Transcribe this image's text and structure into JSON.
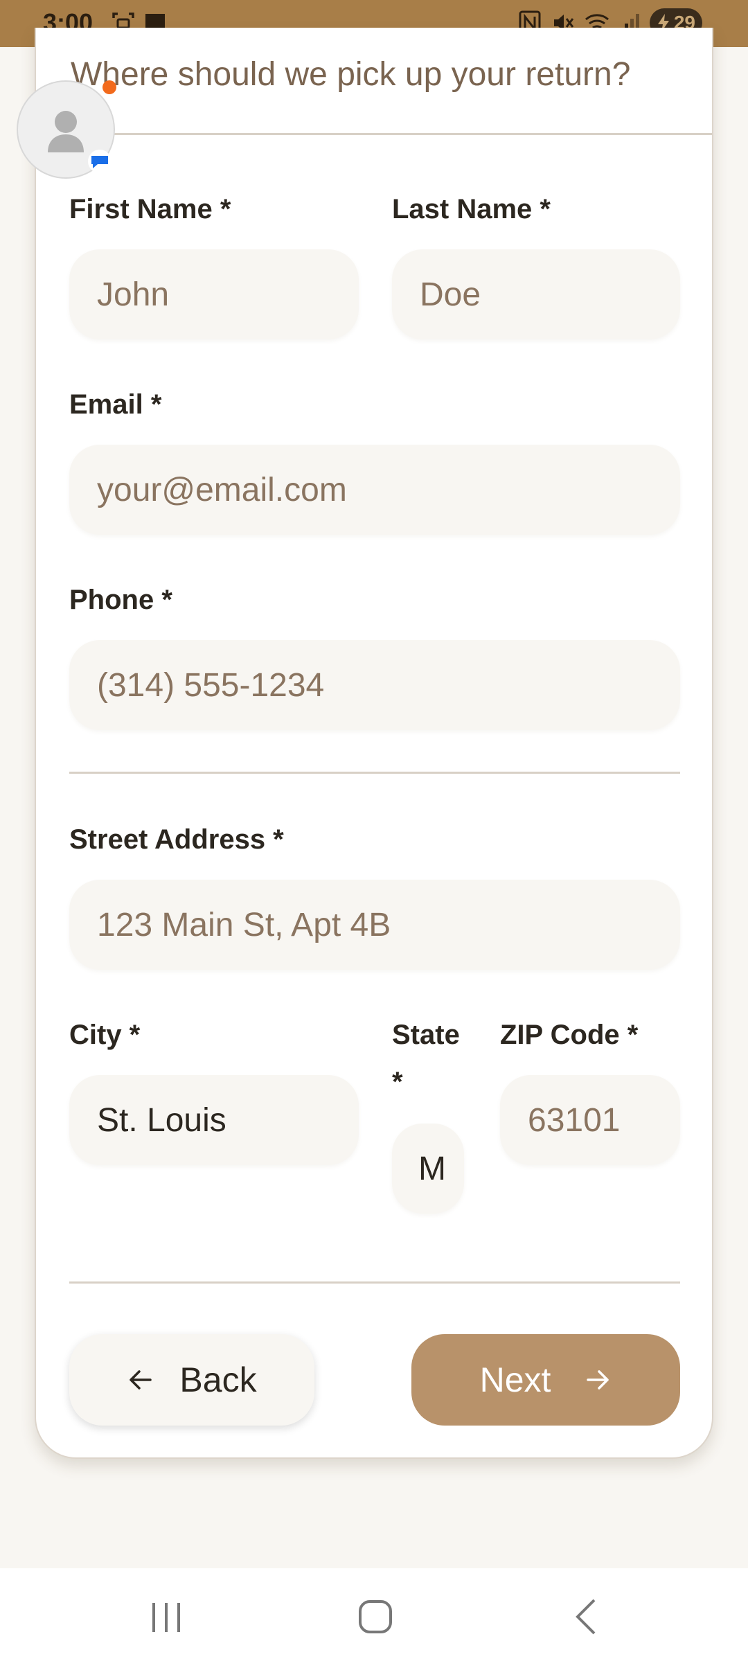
{
  "status_bar": {
    "time": "3:00",
    "battery": "29",
    "icons": [
      "screenshot-icon",
      "chat-icon",
      "nfc-icon",
      "mute-icon",
      "wifi-icon",
      "signal-icon",
      "battery-icon"
    ]
  },
  "form": {
    "subheading": "Where should we pick up your return?",
    "first_name": {
      "label": "First Name *",
      "placeholder": "John"
    },
    "last_name": {
      "label": "Last Name *",
      "placeholder": "Doe"
    },
    "email": {
      "label": "Email *",
      "placeholder": "your@email.com"
    },
    "phone": {
      "label": "Phone *",
      "placeholder": "(314) 555-1234"
    },
    "street": {
      "label": "Street Address *",
      "placeholder": "123 Main St, Apt 4B"
    },
    "city": {
      "label": "City *",
      "value": "St. Louis"
    },
    "state": {
      "label_line1": "State",
      "label_line2": "*",
      "value": "M"
    },
    "zip": {
      "label": "ZIP Code *",
      "placeholder": "63101"
    }
  },
  "buttons": {
    "back": "Back",
    "next": "Next"
  },
  "colors": {
    "status_bar": "#a87e48",
    "accent": "#b8926a",
    "input_bg": "#f8f6f2",
    "notification_dot": "#f26a1c"
  }
}
